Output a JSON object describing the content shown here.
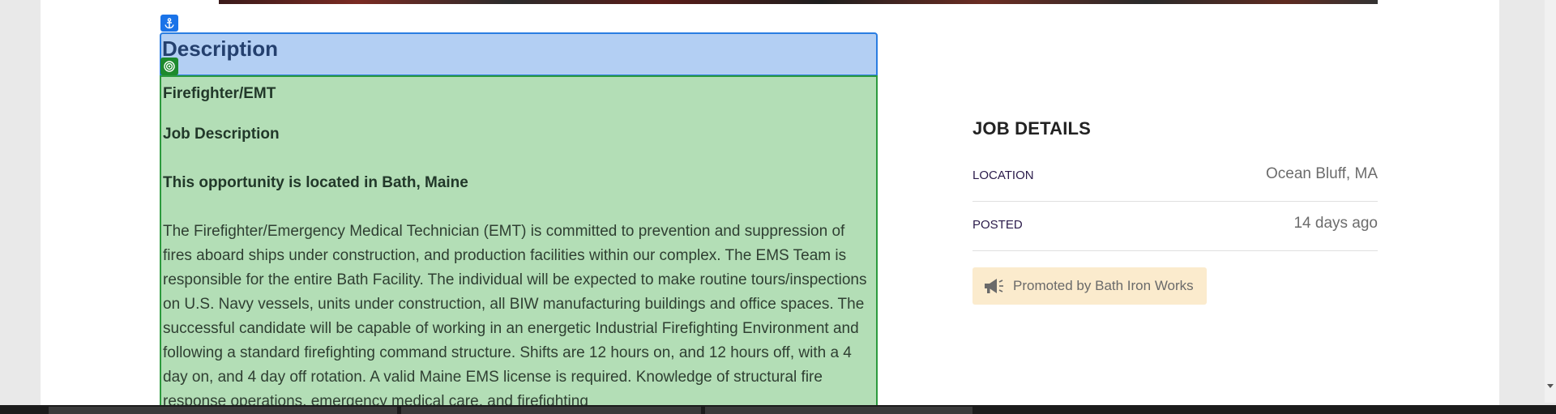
{
  "description": {
    "heading": "Description",
    "job_title": "Firefighter/EMT",
    "job_description_heading": "Job Description",
    "location_line": "This opportunity is located in Bath, Maine",
    "body": "The Firefighter/Emergency Medical Technician (EMT) is committed to prevention and suppression of fires aboard ships under construction, and production facilities within our complex. The EMS Team is responsible for the entire Bath Facility. The individual will be expected to make routine tours/inspections on U.S. Navy vessels, units under construction, all BIW manufacturing buildings and office spaces. The successful candidate will be capable of working in an energetic Industrial Firefighting Environment and following a standard firefighting command structure. Shifts are 12 hours on, and 12 hours off, with a 4 day on, and 4 day off rotation. A valid Maine EMS license is required. Knowledge of structural fire response operations, emergency medical care, and firefighting"
  },
  "job_details": {
    "title": "JOB DETAILS",
    "rows": [
      {
        "label": "LOCATION",
        "value": "Ocean Bluff, MA"
      },
      {
        "label": "POSTED",
        "value": "14 days ago"
      }
    ],
    "promoted": "Promoted by Bath Iron Works"
  },
  "icons": {
    "anchor": "anchor-icon",
    "target": "target-icon",
    "promo": "megaphone-icon"
  },
  "colors": {
    "header_highlight": "#b3cff3",
    "body_highlight": "#b3deb6",
    "promo_bg": "#fbebcd"
  }
}
